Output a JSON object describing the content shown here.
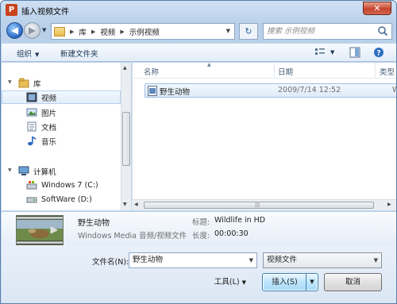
{
  "window": {
    "title": "插入视频文件",
    "app_icon_letter": "P",
    "close_glyph": "✕"
  },
  "nav": {
    "back_glyph": "◀",
    "forward_glyph": "▶",
    "breadcrumb": [
      "库",
      "视频",
      "示例视频"
    ],
    "refresh_glyph": "↻",
    "search_placeholder": "搜索 示例视频"
  },
  "toolbar": {
    "organize": "组织",
    "new_folder": "新建文件夹"
  },
  "sidebar": {
    "libraries_label": "库",
    "libraries": [
      "视频",
      "图片",
      "文档",
      "音乐"
    ],
    "computer_label": "计算机",
    "drives": [
      "Windows 7 (C:)",
      "SoftWare (D:)"
    ]
  },
  "columns": {
    "name": "名称",
    "date": "日期",
    "type": "类型"
  },
  "files": [
    {
      "name": "野生动物",
      "date": "2009/7/14 12:52",
      "type": "Win"
    }
  ],
  "details": {
    "name": "野生动物",
    "type": "Windows Media 音频/视频文件",
    "title_label": "标题:",
    "title_value": "Wildlife in HD",
    "length_label": "长度:",
    "length_value": "00:00:30"
  },
  "bottom": {
    "filename_label": "文件名(N):",
    "filename_value": "野生动物",
    "filetype_value": "视频文件",
    "tools_label": "工具(L)",
    "insert_label": "插入(S)",
    "cancel_label": "取消"
  },
  "colors": {
    "accent": "#3c7fb1",
    "close": "#c7452c",
    "selection": "#deebf9"
  }
}
